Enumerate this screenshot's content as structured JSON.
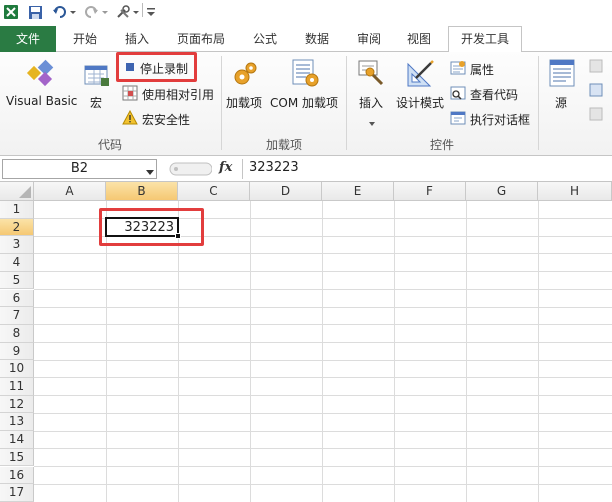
{
  "qat": {
    "app_icon": "excel-icon",
    "save_icon": "save-icon",
    "undo_icon": "undo-icon",
    "redo_icon": "redo-icon",
    "tool_icon": "tools-icon"
  },
  "tabs": {
    "file": "文件",
    "items": [
      "开始",
      "插入",
      "页面布局",
      "公式",
      "数据",
      "审阅",
      "视图",
      "开发工具"
    ],
    "active": "开发工具"
  },
  "ribbon": {
    "code_group": {
      "label": "代码",
      "visual_basic": "Visual Basic",
      "macro": "宏",
      "stop_recording": "停止录制",
      "relative_ref": "使用相对引用",
      "macro_security": "宏安全性"
    },
    "addins_group": {
      "label": "加载项",
      "addins": "加载项",
      "com_addins": "COM 加载项"
    },
    "controls_group": {
      "label": "控件",
      "insert": "插入",
      "design_mode": "设计模式",
      "properties": "属性",
      "view_code": "查看代码",
      "run_dialog": "执行对话框"
    },
    "xml_group": {
      "source": "源"
    }
  },
  "formula_bar": {
    "name_box": "B2",
    "fx": "fx",
    "value": "323223"
  },
  "grid": {
    "columns": [
      "A",
      "B",
      "C",
      "D",
      "E",
      "F",
      "G",
      "H"
    ],
    "rows": [
      "1",
      "2",
      "3",
      "4",
      "5",
      "6",
      "7",
      "8",
      "9",
      "10",
      "11",
      "12",
      "13",
      "14",
      "15",
      "16",
      "17"
    ],
    "selected_column": "B",
    "selected_row": "2",
    "cell_b2": "323223"
  },
  "colors": {
    "file_tab": "#2a7b43",
    "highlight": "#e23d3d",
    "selected_header": "#f5c873"
  }
}
